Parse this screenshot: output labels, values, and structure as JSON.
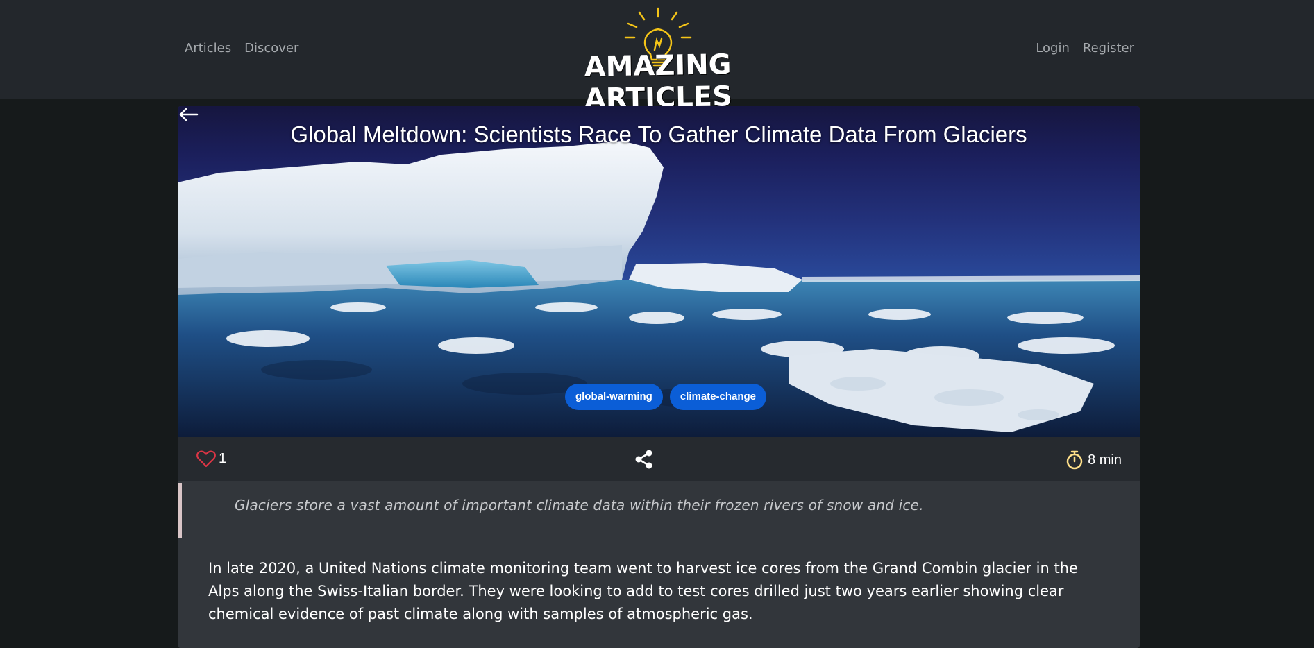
{
  "nav": {
    "left_links": [
      "Articles",
      "Discover"
    ],
    "right_links": [
      "Login",
      "Register"
    ]
  },
  "logo": {
    "text": "AMAZING ARTICLES",
    "accent_color": "#f5c518"
  },
  "article": {
    "title": "Global Meltdown: Scientists Race To Gather Climate Data From Glaciers",
    "tags": [
      "global-warming",
      "climate-change"
    ],
    "likes": "1",
    "read_time": "8 min",
    "summary": "Glaciers store a vast amount of important climate data within their frozen rivers of snow and ice.",
    "body": "In late 2020, a United Nations climate monitoring team went to harvest ice cores from the Grand Combin glacier in the Alps along the Swiss-Italian border. They were looking to add to test cores drilled just two years earlier showing clear chemical evidence of past climate along with samples of atmospheric gas."
  },
  "icons": {
    "back": "arrow-left-icon",
    "like": "heart-icon",
    "share": "share-icon",
    "timer": "stopwatch-icon"
  },
  "colors": {
    "tag_bg": "#0b5ed7",
    "heart": "#dc3545",
    "timer": "#ffe08a",
    "quote_border": "#d9c5c7"
  }
}
